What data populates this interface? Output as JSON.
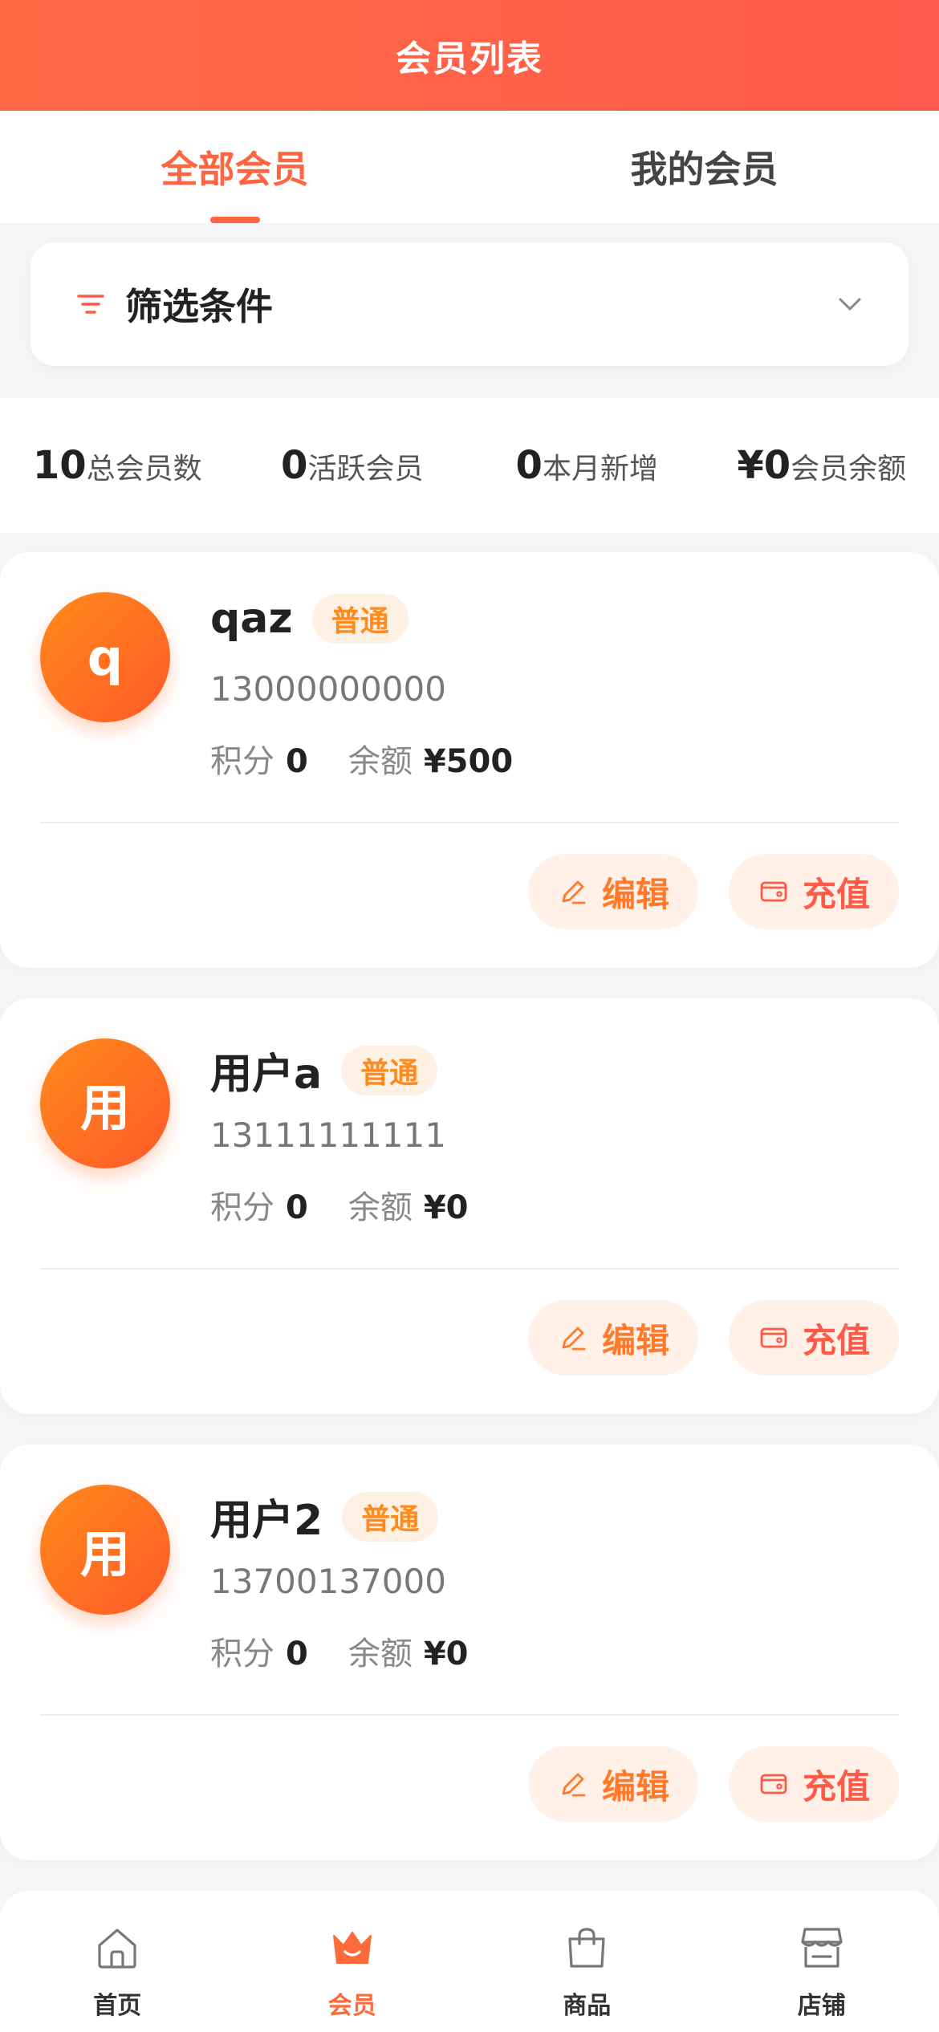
{
  "header": {
    "title": "会员列表"
  },
  "tabs": [
    {
      "label": "全部会员",
      "active": true
    },
    {
      "label": "我的会员",
      "active": false
    }
  ],
  "filter": {
    "label": "筛选条件",
    "icon": "filter-icon",
    "expand_icon": "chevron-down-icon"
  },
  "stats": [
    {
      "value": "10",
      "label": "总会员数"
    },
    {
      "value": "0",
      "label": "活跃会员"
    },
    {
      "value": "0",
      "label": "本月新增"
    },
    {
      "value": "¥0",
      "label": "会员余额"
    }
  ],
  "members": [
    {
      "initial": "q",
      "name": "qaz",
      "level": "普通",
      "phone": "13000000000",
      "points_label": "积分",
      "points": "0",
      "balance_label": "余额",
      "balance": "¥500",
      "edit_label": "编辑",
      "recharge_label": "充值"
    },
    {
      "initial": "用",
      "name": "用户a",
      "level": "普通",
      "phone": "13111111111",
      "points_label": "积分",
      "points": "0",
      "balance_label": "余额",
      "balance": "¥0",
      "edit_label": "编辑",
      "recharge_label": "充值"
    },
    {
      "initial": "用",
      "name": "用户2",
      "level": "普通",
      "phone": "13700137000",
      "points_label": "积分",
      "points": "0",
      "balance_label": "余额",
      "balance": "¥0",
      "edit_label": "编辑",
      "recharge_label": "充值"
    }
  ],
  "nav": [
    {
      "label": "首页",
      "icon": "home-icon",
      "active": false
    },
    {
      "label": "会员",
      "icon": "crown-icon",
      "active": true
    },
    {
      "label": "商品",
      "icon": "shopping-bag-icon",
      "active": false
    },
    {
      "label": "店铺",
      "icon": "store-icon",
      "active": false
    }
  ],
  "colors": {
    "accent": "#ff6540",
    "badge_text": "#ff8a1e",
    "badge_bg": "#fff0e4"
  }
}
